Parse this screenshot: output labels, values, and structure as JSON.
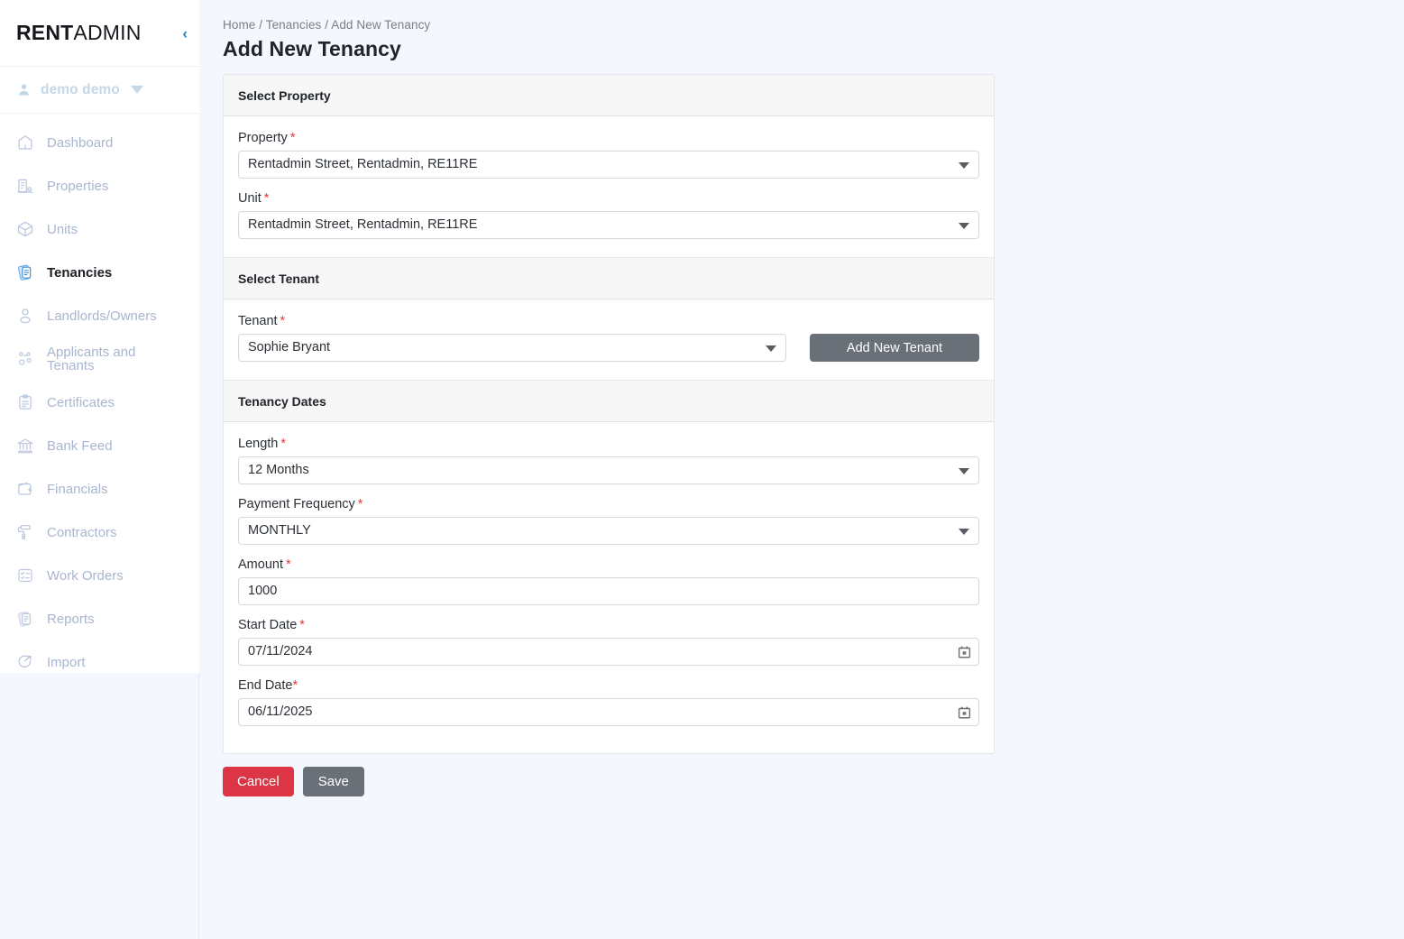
{
  "sidebar": {
    "brand_bold": "RENT",
    "brand_light": "ADMIN",
    "collapse_icon": "chevron-left-icon",
    "user": {
      "name": "demo demo",
      "avatar_icon": "person-icon",
      "caret_icon": "caret-down-icon"
    },
    "items": [
      {
        "label": "Dashboard",
        "icon": "home-icon",
        "active": false
      },
      {
        "label": "Properties",
        "icon": "building-icon",
        "active": false
      },
      {
        "label": "Units",
        "icon": "cube-icon",
        "active": false
      },
      {
        "label": "Tenancies",
        "icon": "document-stack-icon",
        "active": true
      },
      {
        "label": "Landlords/Owners",
        "icon": "user-icon",
        "active": false
      },
      {
        "label": "Applicants and Tenants",
        "icon": "users-group-icon",
        "active": false
      },
      {
        "label": "Certificates",
        "icon": "clipboard-icon",
        "active": false
      },
      {
        "label": "Bank Feed",
        "icon": "bank-icon",
        "active": false
      },
      {
        "label": "Financials",
        "icon": "wallet-icon",
        "active": false
      },
      {
        "label": "Contractors",
        "icon": "paint-roller-icon",
        "active": false
      },
      {
        "label": "Work Orders",
        "icon": "checklist-icon",
        "active": false
      },
      {
        "label": "Reports",
        "icon": "report-icon",
        "active": false
      },
      {
        "label": "Import",
        "icon": "import-arrow-icon",
        "active": false
      }
    ]
  },
  "header": {
    "breadcrumb": "Home / Tenancies / Add New Tenancy",
    "title": "Add New Tenancy"
  },
  "form": {
    "select_property": {
      "section_title": "Select Property",
      "property": {
        "label": "Property",
        "required": "*",
        "value": "Rentadmin Street, Rentadmin, RE11RE"
      },
      "unit": {
        "label": "Unit",
        "required": "*",
        "value": "Rentadmin Street, Rentadmin, RE11RE"
      }
    },
    "select_tenant": {
      "section_title": "Select Tenant",
      "tenant": {
        "label": "Tenant",
        "required": "*",
        "value": "Sophie Bryant"
      },
      "add_new_tenant_label": "Add New Tenant"
    },
    "tenancy_dates": {
      "section_title": "Tenancy Dates",
      "length": {
        "label": "Length",
        "required": "*",
        "value": "12 Months"
      },
      "payment_frequency": {
        "label": "Payment Frequency",
        "required": "*",
        "value": "MONTHLY"
      },
      "amount": {
        "label": "Amount",
        "required": "*",
        "value": "1000"
      },
      "start_date": {
        "label": "Start Date",
        "required": "*",
        "value": "07/11/2024",
        "icon": "calendar-icon"
      },
      "end_date": {
        "label": "End Date",
        "required": "*",
        "value": "06/11/2025",
        "icon": "calendar-icon"
      }
    }
  },
  "footer": {
    "cancel_label": "Cancel",
    "save_label": "Save"
  },
  "colors": {
    "page_bg": "#f4f7fd",
    "accent_blue": "#1f7fc4",
    "danger": "#dc3545",
    "secondary": "#6a7077",
    "required_star": "#e33a3a",
    "muted_nav": "#a9b6cf"
  }
}
